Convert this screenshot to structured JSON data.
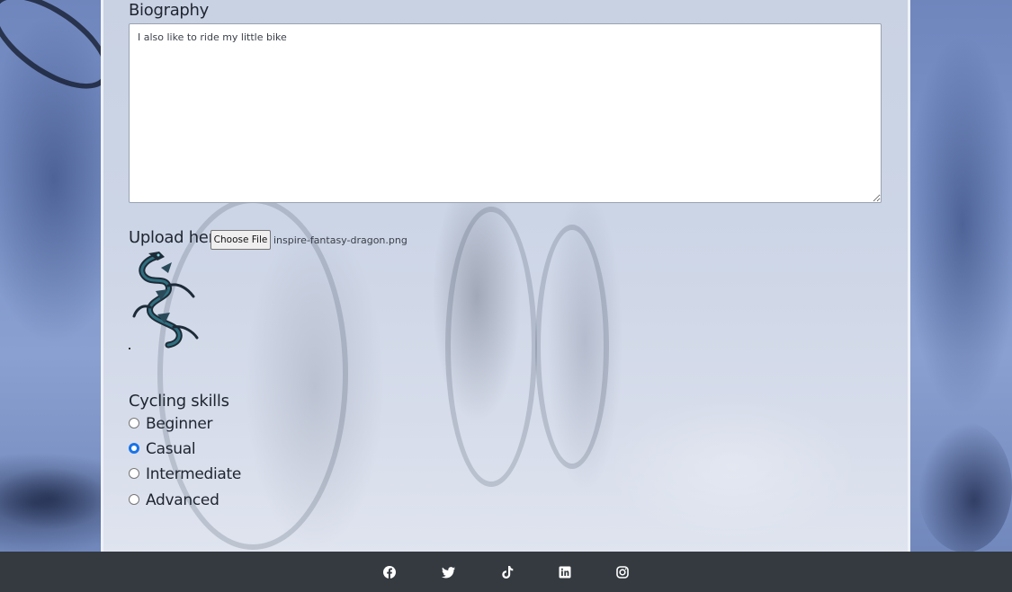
{
  "form": {
    "biography": {
      "label": "Biography",
      "value": "I also like to ride my little bike"
    },
    "upload": {
      "label": "Upload here:",
      "button_label": "Choose File",
      "file_name": "inspire-fantasy-dragon.png",
      "preview_icon": "dragon-image"
    },
    "cycling_skills": {
      "label": "Cycling skills",
      "options": [
        {
          "label": "Beginner",
          "checked": false
        },
        {
          "label": "Casual",
          "checked": true
        },
        {
          "label": "Intermediate",
          "checked": false
        },
        {
          "label": "Advanced",
          "checked": false
        }
      ],
      "selected": "Casual"
    }
  },
  "footer": {
    "social_icons": [
      "facebook-icon",
      "twitter-icon",
      "tiktok-icon",
      "linkedin-icon",
      "instagram-icon"
    ]
  },
  "colors": {
    "footer_bg": "#343a40",
    "radio_checked": "#1a73e8",
    "background_blue": "#7d95cb"
  }
}
